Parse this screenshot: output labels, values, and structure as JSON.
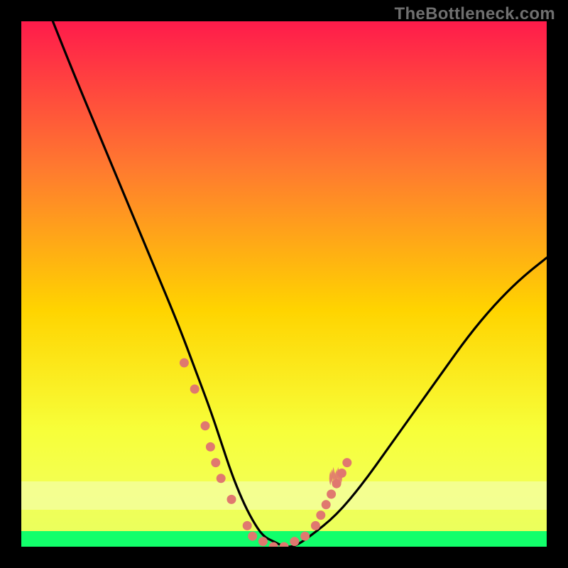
{
  "watermark": {
    "text": "TheBottleneck.com"
  },
  "colors": {
    "top": "#ff1b4b",
    "mid_upper": "#ff7a2f",
    "mid": "#ffd400",
    "mid_lower": "#f7ff3a",
    "band": "#d4ff4a",
    "bottom_green": "#12ff6b",
    "curve": "#000000",
    "marker": "#e0786f"
  },
  "chart_data": {
    "type": "line",
    "title": "",
    "xlabel": "",
    "ylabel": "",
    "xlim": [
      0,
      100
    ],
    "ylim": [
      0,
      100
    ],
    "series": [
      {
        "name": "bottleneck-curve",
        "x": [
          6,
          10,
          15,
          20,
          25,
          30,
          33,
          36,
          38,
          40,
          42,
          44,
          46,
          48,
          50,
          52,
          55,
          60,
          65,
          70,
          75,
          80,
          85,
          90,
          95,
          100
        ],
        "y": [
          100,
          90,
          78,
          66,
          54,
          42,
          34,
          26,
          20,
          14,
          9,
          5,
          2,
          1,
          0,
          0,
          2,
          6,
          12,
          19,
          26,
          33,
          40,
          46,
          51,
          55
        ]
      }
    ],
    "markers": [
      {
        "x": 31,
        "y": 35
      },
      {
        "x": 33,
        "y": 30
      },
      {
        "x": 35,
        "y": 23
      },
      {
        "x": 36,
        "y": 19
      },
      {
        "x": 37,
        "y": 16
      },
      {
        "x": 38,
        "y": 13
      },
      {
        "x": 40,
        "y": 9
      },
      {
        "x": 43,
        "y": 4
      },
      {
        "x": 44,
        "y": 2
      },
      {
        "x": 46,
        "y": 1
      },
      {
        "x": 48,
        "y": 0
      },
      {
        "x": 50,
        "y": 0
      },
      {
        "x": 52,
        "y": 1
      },
      {
        "x": 54,
        "y": 2
      },
      {
        "x": 56,
        "y": 4
      },
      {
        "x": 57,
        "y": 6
      },
      {
        "x": 58,
        "y": 8
      },
      {
        "x": 59,
        "y": 10
      },
      {
        "x": 60,
        "y": 12
      },
      {
        "x": 61,
        "y": 14
      },
      {
        "x": 62,
        "y": 16
      }
    ],
    "flame_cluster": {
      "x": 60,
      "y": 13,
      "count": 8
    }
  }
}
